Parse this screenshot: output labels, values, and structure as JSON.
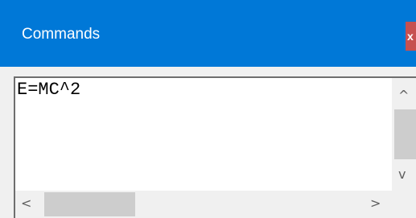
{
  "window": {
    "title": "Commands",
    "close_label": "x"
  },
  "editor": {
    "content": "E=MC^2"
  },
  "scrollbars": {
    "up_arrow": "^",
    "down_arrow": "v",
    "left_arrow": "<",
    "right_arrow": ">"
  },
  "colors": {
    "titlebar": "#0078d7",
    "close_button": "#c75050",
    "scroll_thumb": "#cdcdcd"
  }
}
